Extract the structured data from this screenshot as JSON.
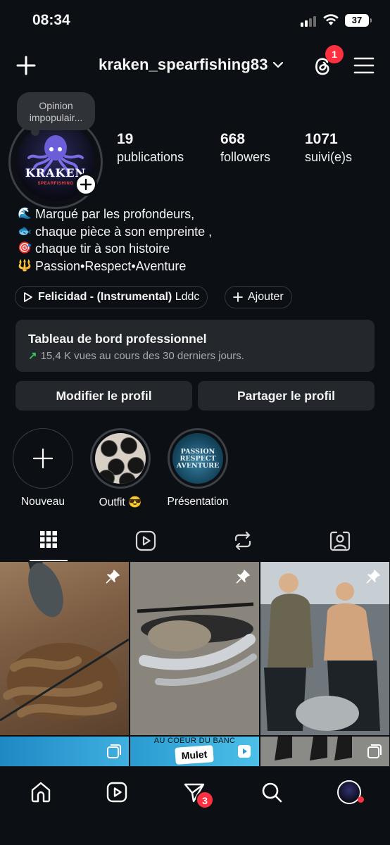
{
  "status_bar": {
    "time": "08:34",
    "battery": "37"
  },
  "header": {
    "username": "kraken_spearfishing83",
    "notification_count": "1"
  },
  "profile": {
    "note": "Opinion impopulair...",
    "avatar_brand": "KRAKEN",
    "avatar_sub": "SPEARFISHING",
    "stats": [
      {
        "value": "19",
        "label": "publications"
      },
      {
        "value": "668",
        "label": "followers"
      },
      {
        "value": "1071",
        "label": "suivi(e)s"
      }
    ],
    "bio": [
      {
        "emoji": "🌊",
        "text": "Marqué par les profondeurs,"
      },
      {
        "emoji": "🐟",
        "text": "chaque pièce à son empreinte ,"
      },
      {
        "emoji": "🎯",
        "text": "chaque tir à son histoire"
      },
      {
        "emoji": "🔱",
        "text": "Passion•Respect•Aventure"
      }
    ],
    "music": {
      "title": "Felicidad - (Instrumental)",
      "artist": "Lddc"
    },
    "add_label": "Ajouter"
  },
  "dashboard": {
    "title": "Tableau de bord professionnel",
    "subtitle": "15,4 K vues au cours des 30 derniers jours."
  },
  "actions": {
    "edit": "Modifier le profil",
    "share": "Partager le profil"
  },
  "highlights": [
    {
      "label": "Nouveau"
    },
    {
      "label": "Outfit 😎"
    },
    {
      "label": "Présentation",
      "cover_text": "PASSION RESPECT AVENTURE"
    }
  ],
  "grid": {
    "banner_text": "AU COEUR DU BANC",
    "tag_text": "Mulet"
  },
  "bottom_nav": {
    "messages_count": "3"
  },
  "colors": {
    "background": "#0c1014",
    "surface": "#24272c",
    "badge": "#ff3040",
    "growth": "#36c25a"
  }
}
